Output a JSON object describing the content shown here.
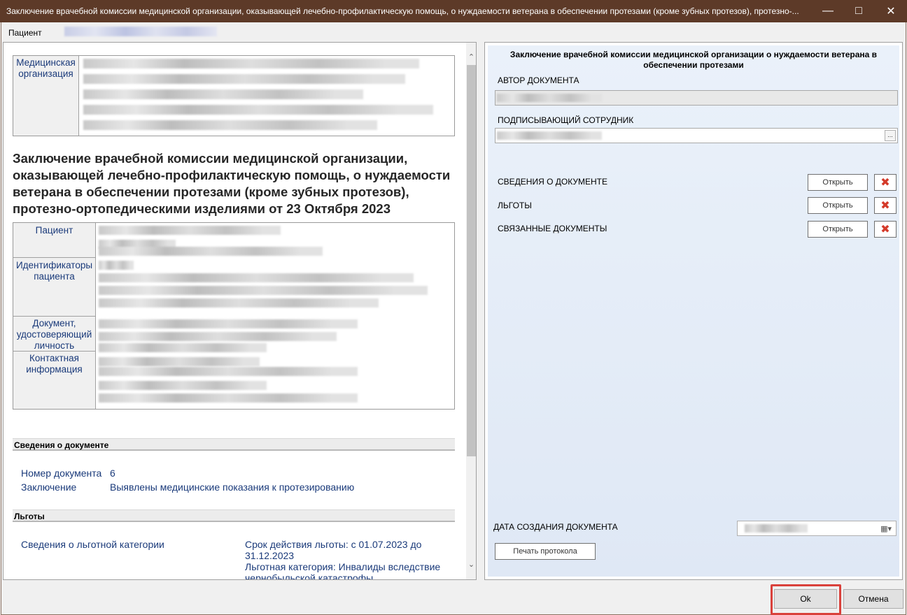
{
  "window": {
    "title": "Заключение врачебной комиссии медицинской организации, оказывающей лечебно-профилактическую помощь, о нуждаемости ветерана в обеспечении протезами (кроме зубных протезов), протезно-..."
  },
  "patient_bar": {
    "label": "Пациент"
  },
  "document": {
    "org_label": "Медицинская организация",
    "heading": "Заключение врачебной комиссии медицинской организации, оказывающей лечебно-профилактическую помощь, о нуждаемости ветерана в обеспечении протезами (кроме зубных протезов), протезно-ортопедическими изделиями от 23 Октября 2023",
    "patient_table": {
      "patient": "Пациент",
      "identifiers": "Идентификаторы пациента",
      "id_document": "Документ, удостоверяющий личность",
      "contact": "Контактная информация"
    },
    "details_section": {
      "title": "Сведения о документе",
      "number_label": "Номер документа",
      "number_value": "6",
      "conclusion_label": "Заключение",
      "conclusion_value": "Выявлены медицинские показания к протезированию"
    },
    "benefits_section": {
      "title": "Льготы",
      "category_label": "Сведения о льготной категории",
      "validity": "Срок действия льготы: с 01.07.2023 до 31.12.2023",
      "category": "Льготная категория: Инвалиды вследствие чернобыльской катастрофы"
    }
  },
  "form": {
    "title": "Заключение врачебной комиссии медицинской организации о нуждаемости ветерана в обеспечении протезами",
    "author_label": "АВТОР ДОКУМЕНТА",
    "signer_label": "ПОДПИСЫВАЮЩИЙ СОТРУДНИК",
    "dots": "...",
    "rows": [
      {
        "label": "СВЕДЕНИЯ О ДОКУМЕНТЕ",
        "open": "Открыть"
      },
      {
        "label": "ЛЬГОТЫ",
        "open": "Открыть"
      },
      {
        "label": "СВЯЗАННЫЕ ДОКУМЕНТЫ",
        "open": "Открыть"
      }
    ],
    "date_label": "ДАТА СОЗДАНИЯ ДОКУМЕНТА",
    "print_label": "Печать протокола"
  },
  "footer": {
    "ok": "Ok",
    "cancel": "Отмена"
  },
  "colors": {
    "titlebar": "#5d3a28",
    "link": "#1a3a7a",
    "highlight": "#d9413b"
  }
}
